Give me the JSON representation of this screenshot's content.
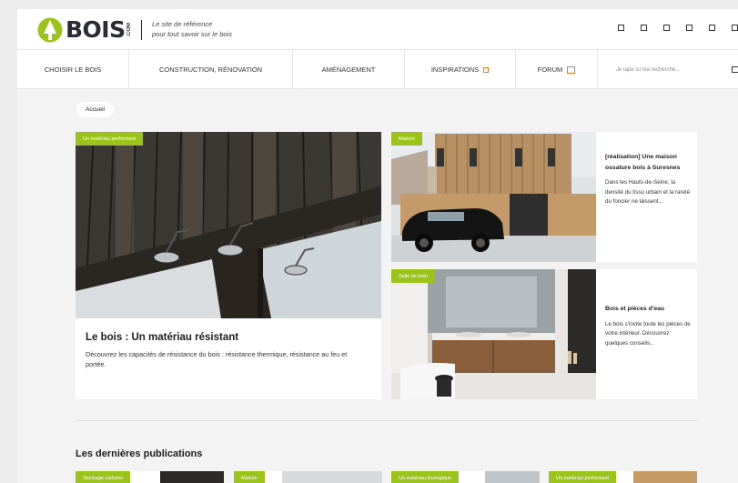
{
  "header": {
    "logo_text": "BOIS",
    "logo_suffix": ".COM",
    "tagline_line1": "Le site de référence",
    "tagline_line2": "pour tout savoir sur le bois",
    "social_icons": [
      "social-icon-1",
      "social-icon-2",
      "social-icon-3",
      "social-icon-4",
      "social-icon-5",
      "social-icon-6"
    ]
  },
  "nav": {
    "items": [
      {
        "label": "CHOISIR LE BOIS"
      },
      {
        "label": "CONSTRUCTION, RÉNOVATION"
      },
      {
        "label": "AMÉNAGEMENT"
      },
      {
        "label": "INSPIRATIONS"
      },
      {
        "label": "FORUM"
      }
    ],
    "search_placeholder": "Je tape ici ma recherche..."
  },
  "breadcrumb": {
    "label": "Accueil"
  },
  "featured": {
    "tag": "Un matériau performant",
    "title": "Le bois : Un matériau résistant",
    "description": "Découvrez les capacités de résistance du bois : résistance thermique, résistance au feu et portée."
  },
  "side_articles": [
    {
      "tag": "Maison",
      "title": "[réalisation] Une maison ossature bois à Suresnes",
      "description": "Dans les Hauts-de-Seine, la densité du tissu urbain et la rareté du foncier ne laissent..."
    },
    {
      "tag": "Salle de bain",
      "title": "Bois et pièces d'eau",
      "description": "Le bois s'invite toute les pièces de votre intérieur. Découvrez quelques conseils..."
    }
  ],
  "latest": {
    "title": "Les dernières publications",
    "tags": [
      "Stockage carbone",
      "Maison",
      "Un matériau écologique",
      "Un matériau performant"
    ]
  },
  "colors": {
    "accent": "#9bc31c",
    "orange": "#f07a1a",
    "dark": "#2b2b35"
  }
}
